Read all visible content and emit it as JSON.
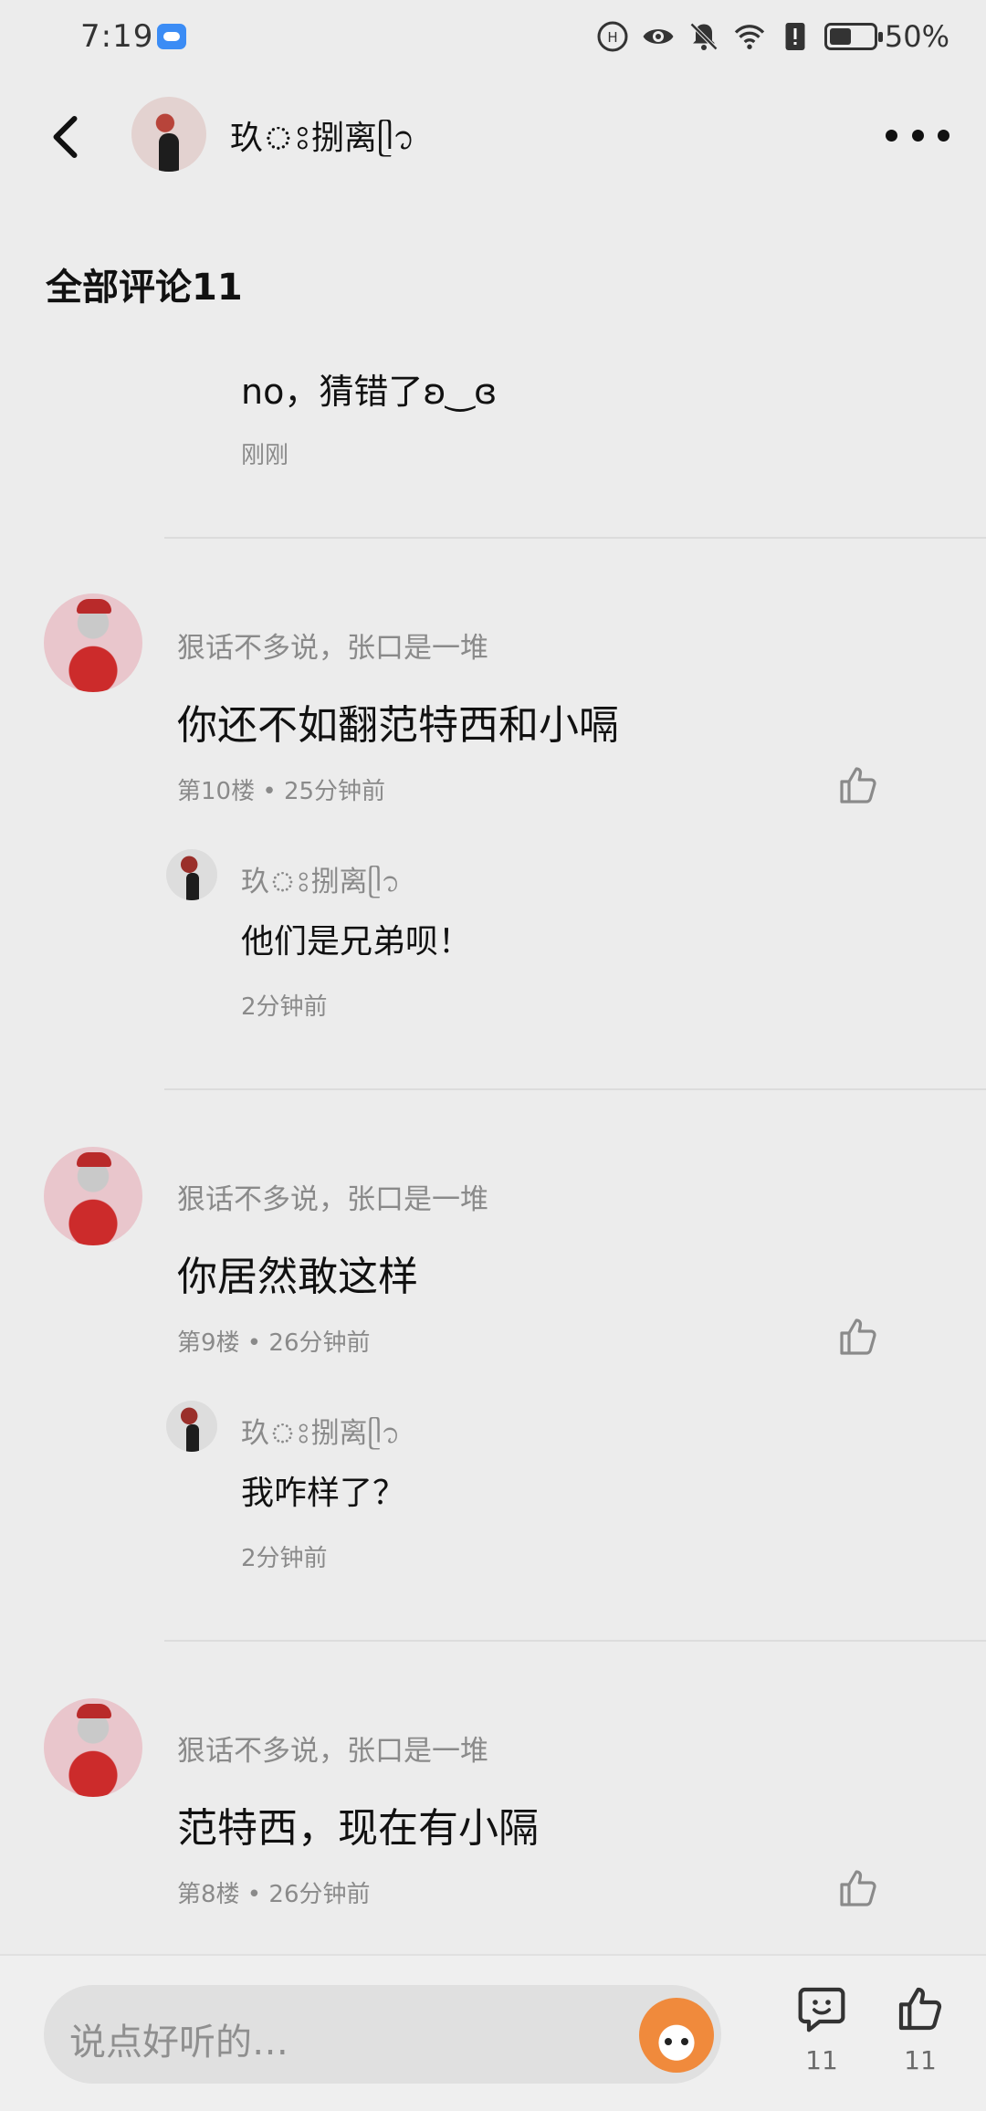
{
  "status_bar": {
    "time": "7:19",
    "battery_pct": "50%",
    "battery_level": 0.5
  },
  "header": {
    "name": "玖ঃ捌离ᥫ᭡"
  },
  "section": {
    "title": "全部评论11"
  },
  "top_reply": {
    "text": "no，猜错了ʚ‿ɞ",
    "time": "刚刚"
  },
  "comments": [
    {
      "author": "狠话不多说，张口是一堆",
      "text": "你还不如翻范特西和小嗝",
      "meta": "第10楼 • 25分钟前",
      "reply": {
        "name": "玖ঃ捌离ᥫ᭡",
        "text": "他们是兄弟呗！",
        "time": "2分钟前"
      }
    },
    {
      "author": "狠话不多说，张口是一堆",
      "text": "你居然敢这样",
      "meta": "第9楼 • 26分钟前",
      "reply": {
        "name": "玖ঃ捌离ᥫ᭡",
        "text": "我咋样了？",
        "time": "2分钟前"
      }
    },
    {
      "author": "狠话不多说，张口是一堆",
      "text": "范特西，现在有小隔",
      "meta": "第8楼 • 26分钟前"
    }
  ],
  "bottom_bar": {
    "placeholder": "说点好听的…",
    "comment_count": "11",
    "like_count": "11"
  }
}
